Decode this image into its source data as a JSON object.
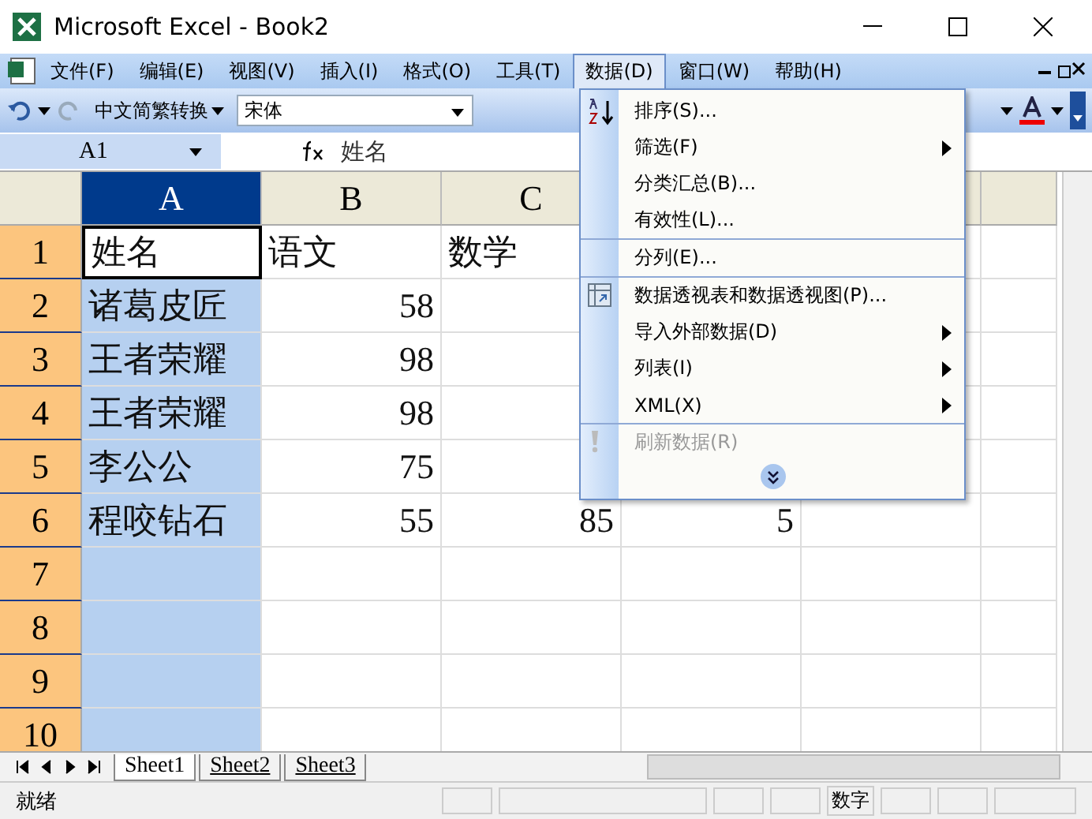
{
  "window": {
    "title": "Microsoft Excel - Book2"
  },
  "menu_bar": [
    {
      "label": "文件(F)",
      "selected": false
    },
    {
      "label": "编辑(E)",
      "selected": false
    },
    {
      "label": "视图(V)",
      "selected": false
    },
    {
      "label": "插入(I)",
      "selected": false
    },
    {
      "label": "格式(O)",
      "selected": false
    },
    {
      "label": "工具(T)",
      "selected": false
    },
    {
      "label": "数据(D)",
      "selected": true
    },
    {
      "label": "窗口(W)",
      "selected": false
    },
    {
      "label": "帮助(H)",
      "selected": false
    }
  ],
  "toolbar": {
    "convert_button": "中文简繁转换",
    "font": "宋体"
  },
  "formula_bar": {
    "name_box": "A1",
    "formula": "姓名"
  },
  "columns": [
    {
      "label": "A",
      "selected": true
    },
    {
      "label": "B",
      "selected": false
    },
    {
      "label": "C",
      "selected": false
    }
  ],
  "rows": [
    {
      "header": "1",
      "selected": true,
      "cells": [
        "姓名",
        "语文",
        "数学"
      ]
    },
    {
      "header": "2",
      "selected": true,
      "cells": [
        "诸葛皮匠",
        "58"
      ]
    },
    {
      "header": "3",
      "selected": true,
      "cells": [
        "王者荣耀",
        "98"
      ]
    },
    {
      "header": "4",
      "selected": true,
      "cells": [
        "王者荣耀",
        "98"
      ]
    },
    {
      "header": "5",
      "selected": true,
      "cells": [
        "李公公",
        "75"
      ]
    },
    {
      "header": "6",
      "selected": true,
      "cells": [
        "程咬钻石",
        "55",
        "85",
        "5"
      ]
    },
    {
      "header": "7",
      "selected": true
    },
    {
      "header": "8",
      "selected": true
    },
    {
      "header": "9",
      "selected": true
    },
    {
      "header": "10",
      "selected": true
    }
  ],
  "data_menu": [
    {
      "label": "排序(S)...",
      "kind": "item",
      "disabled": false,
      "separator_before": false
    },
    {
      "label": "筛选(F)",
      "kind": "submenu",
      "disabled": false,
      "separator_before": false
    },
    {
      "label": "分类汇总(B)...",
      "kind": "item",
      "disabled": false,
      "separator_before": false
    },
    {
      "label": "有效性(L)...",
      "kind": "item",
      "disabled": false,
      "separator_before": false
    },
    {
      "label": "分列(E)...",
      "kind": "item",
      "disabled": false,
      "separator_before": true
    },
    {
      "label": "数据透视表和数据透视图(P)...",
      "kind": "item",
      "disabled": false,
      "separator_before": true
    },
    {
      "label": "导入外部数据(D)",
      "kind": "submenu",
      "disabled": false,
      "separator_before": false
    },
    {
      "label": "列表(I)",
      "kind": "submenu",
      "disabled": false,
      "separator_before": false
    },
    {
      "label": "XML(X)",
      "kind": "submenu",
      "disabled": false,
      "separator_before": false
    },
    {
      "label": "刷新数据(R)",
      "kind": "item",
      "disabled": true,
      "separator_before": true
    }
  ],
  "sheet_tabs": [
    {
      "label": "Sheet1",
      "selected": true
    },
    {
      "label": "Sheet2",
      "selected": false
    },
    {
      "label": "Sheet3",
      "selected": false
    }
  ],
  "status_bar": {
    "status": "就绪",
    "indicator": "数字"
  }
}
